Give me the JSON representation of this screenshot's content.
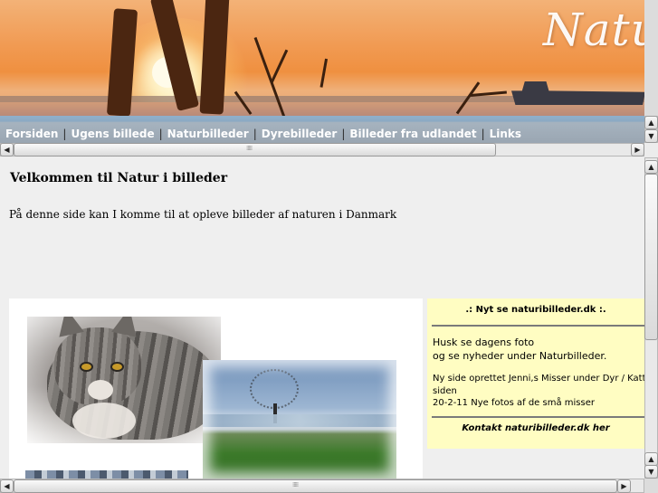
{
  "header": {
    "banner_title": "Natur"
  },
  "nav": {
    "items": [
      {
        "label": "Forsiden"
      },
      {
        "label": "Ugens billede"
      },
      {
        "label": "Naturbilleder"
      },
      {
        "label": "Dyrebilleder"
      },
      {
        "label": "Billeder fra udlandet"
      },
      {
        "label": "Links"
      }
    ],
    "separator": "|"
  },
  "main": {
    "title": "Velkommen til Natur i billeder",
    "intro": "På denne side kan I komme til at opleve billeder af naturen i Danmark"
  },
  "news": {
    "heading": ".: Nyt se naturibilleder.dk :.",
    "line1": "Husk se dagens foto",
    "line2": "og se nyheder under Naturbilleder.",
    "line3": "Ny side oprettet Jenni,s Misser under Dyr / Katte",
    "line4": "siden",
    "line5": "20-2-11 Nye fotos af de små misser",
    "contact": "Kontakt naturibilleder.dk her"
  },
  "scrollbars": {
    "up_arrow": "▲",
    "down_arrow": "▼",
    "left_arrow": "◀",
    "right_arrow": "▶",
    "grip": "⁞⁞⁞⁞⁞"
  },
  "icons": {
    "scroll-up": "▲",
    "scroll-down": "▼",
    "scroll-left": "◀",
    "scroll-right": "▶"
  },
  "colors": {
    "nav_bar": "#9aa6b2",
    "nav_text": "#ffffff",
    "news_bg": "#fffdc2",
    "content_bg": "#efefef"
  }
}
